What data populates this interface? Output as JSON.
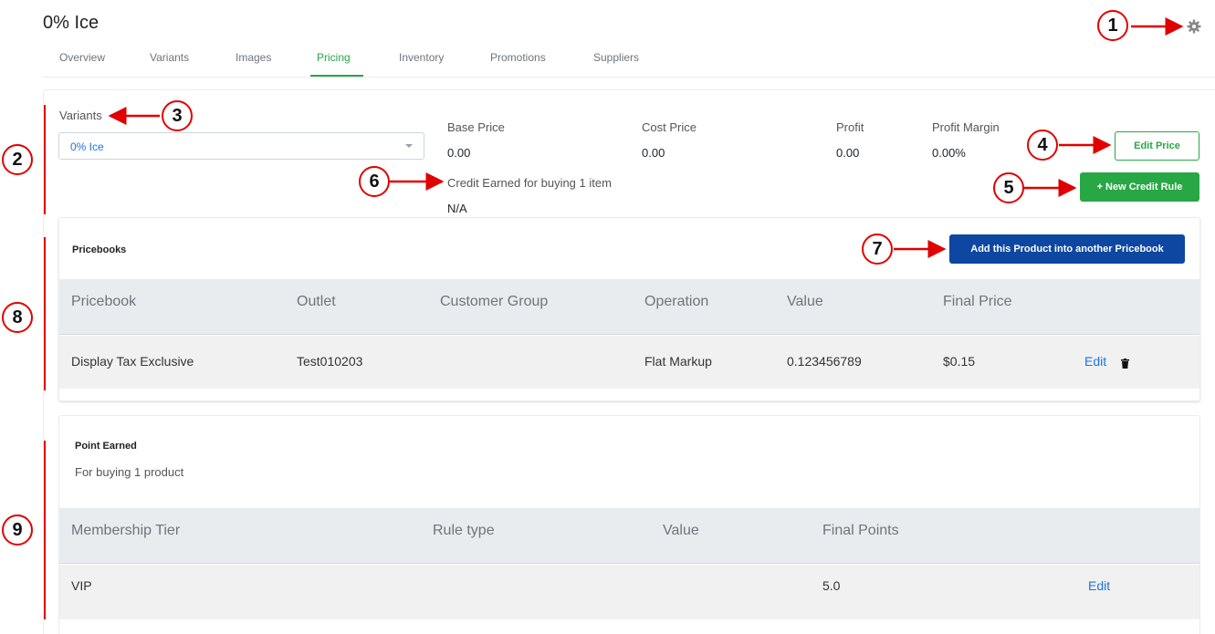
{
  "page": {
    "title": "0% Ice"
  },
  "tabs": [
    {
      "label": "Overview"
    },
    {
      "label": "Variants"
    },
    {
      "label": "Images"
    },
    {
      "label": "Pricing"
    },
    {
      "label": "Inventory"
    },
    {
      "label": "Promotions"
    },
    {
      "label": "Suppliers"
    }
  ],
  "active_tab": "Pricing",
  "variants": {
    "label": "Variants",
    "selected": "0% Ice"
  },
  "prices": {
    "base_label": "Base Price",
    "base_value": "0.00",
    "cost_label": "Cost Price",
    "cost_value": "0.00",
    "profit_label": "Profit",
    "profit_value": "0.00",
    "margin_label": "Profit Margin",
    "margin_value": "0.00%"
  },
  "credit": {
    "label": "Credit Earned for buying 1 item",
    "value": "N/A"
  },
  "buttons": {
    "edit_price": "Edit Price",
    "new_credit_rule": "+ New Credit Rule",
    "add_to_pricebook": "Add this Product into another Pricebook"
  },
  "pricebooks": {
    "title": "Pricebooks",
    "headers": [
      "Pricebook",
      "Outlet",
      "Customer Group",
      "Operation",
      "Value",
      "Final Price"
    ],
    "rows": [
      {
        "pricebook": "Display Tax Exclusive",
        "outlet": "Test010203",
        "customer_group": "",
        "operation": "Flat Markup",
        "value": "0.123456789",
        "final_price": "$0.15",
        "edit": "Edit"
      }
    ]
  },
  "points": {
    "title": "Point Earned",
    "subtitle": "For buying 1 product",
    "headers": [
      "Membership Tier",
      "Rule type",
      "Value",
      "Final Points"
    ],
    "rows": [
      {
        "tier": "VIP",
        "rule_type": "",
        "value": "",
        "final_points": "5.0",
        "edit": "Edit"
      }
    ]
  },
  "annotations": [
    "1",
    "2",
    "3",
    "4",
    "5",
    "6",
    "7",
    "8",
    "9"
  ],
  "colors": {
    "accent_green": "#28a745",
    "button_blue": "#0d47a1",
    "link_blue": "#1a73e8",
    "annotation_red": "#e00000"
  }
}
